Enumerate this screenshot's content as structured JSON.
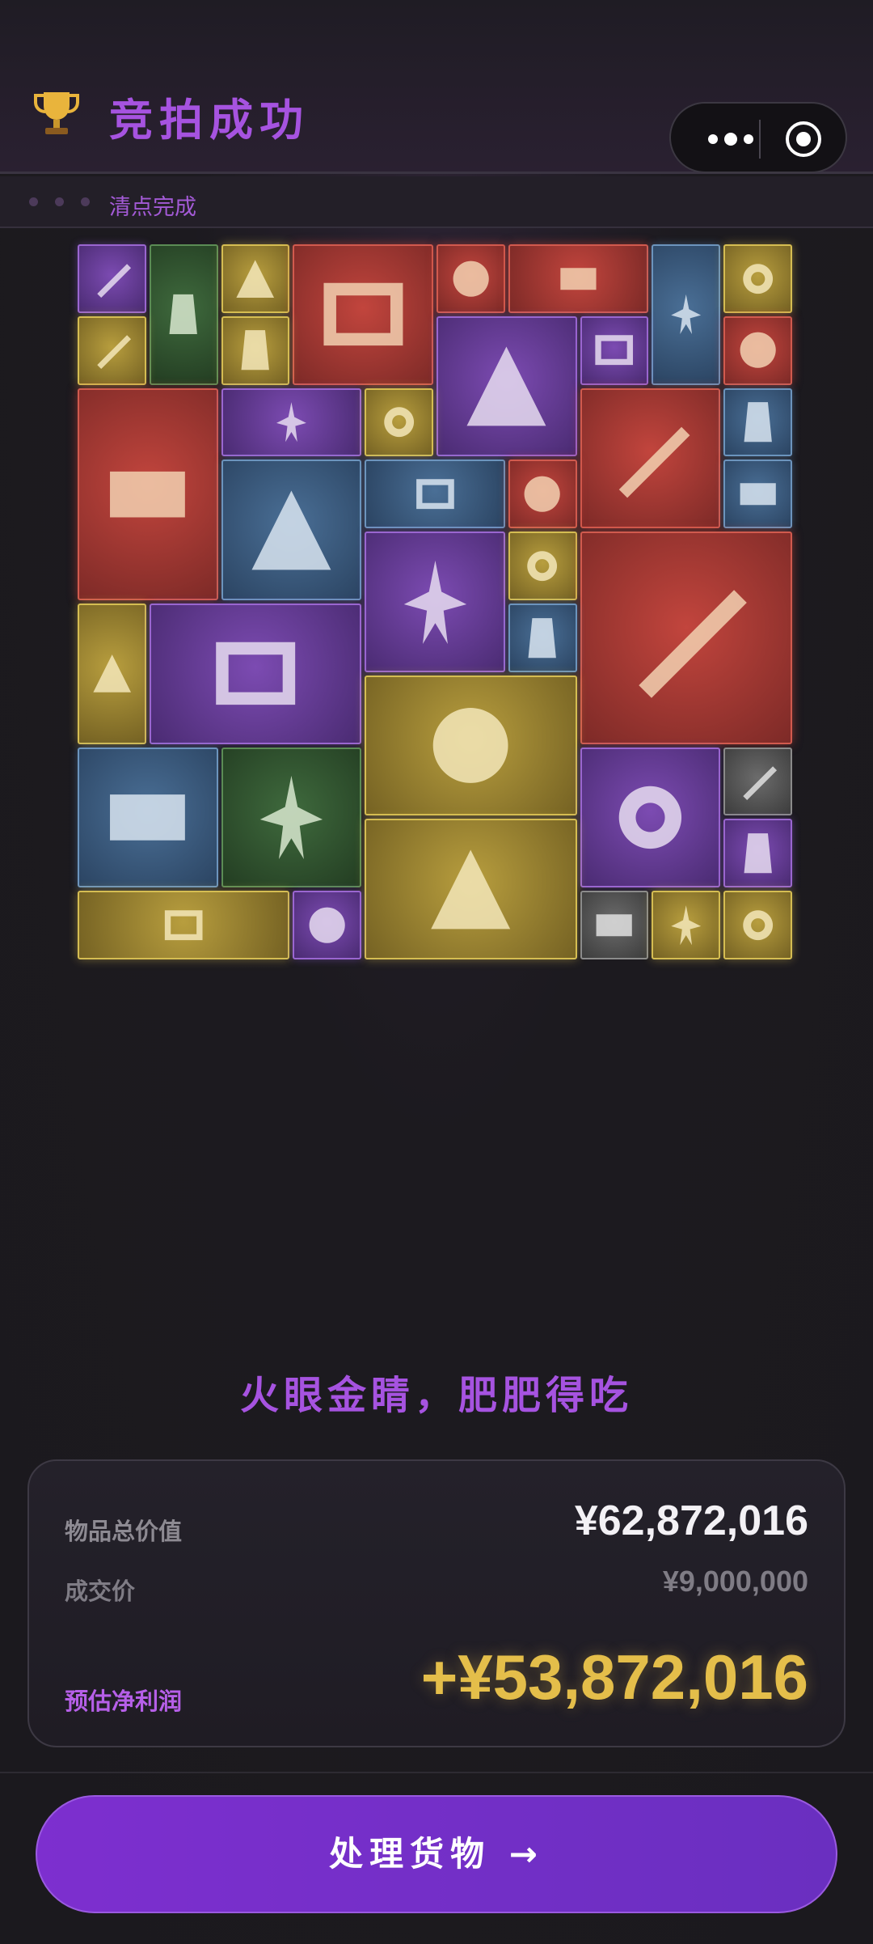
{
  "header": {
    "title": "竞拍成功",
    "trophy_icon": "trophy-icon",
    "menu_icon": "more-dots-icon",
    "close_icon": "target-circle-icon"
  },
  "progress": {
    "label": "清点完成",
    "dots": 3
  },
  "grid": {
    "items": [
      {
        "name": "knife-icon",
        "color": "purple"
      },
      {
        "name": "coffee-bag-icon",
        "color": "green"
      },
      {
        "name": "snack-pack-icon",
        "color": "gold"
      },
      {
        "name": "engine-module-icon",
        "color": "red"
      },
      {
        "name": "orb-icon",
        "color": "red"
      },
      {
        "name": "tablet-device-icon",
        "color": "red"
      },
      {
        "name": "ballerina-statue-icon",
        "color": "blue"
      },
      {
        "name": "ring-icon",
        "color": "gold"
      },
      {
        "name": "power-meter-icon",
        "color": "gold"
      },
      {
        "name": "ssd-icon",
        "color": "gold"
      },
      {
        "name": "coffee-machine-icon",
        "color": "purple"
      },
      {
        "name": "white-vest-icon",
        "color": "purple"
      },
      {
        "name": "compass-icon",
        "color": "red"
      },
      {
        "name": "bust-statue-icon",
        "color": "red"
      },
      {
        "name": "edc-pack-icon",
        "color": "purple"
      },
      {
        "name": "multimeter-icon",
        "color": "gold"
      },
      {
        "name": "radio-device-icon",
        "color": "red"
      },
      {
        "name": "caliper-icon",
        "color": "blue"
      },
      {
        "name": "thermometer-display-icon",
        "color": "blue"
      },
      {
        "name": "drill-icon",
        "color": "blue"
      },
      {
        "name": "orb-icon",
        "color": "red"
      },
      {
        "name": "mp3-player-icon",
        "color": "blue"
      },
      {
        "name": "hard-drive-icon",
        "color": "purple"
      },
      {
        "name": "bottle-icon",
        "color": "gold"
      },
      {
        "name": "framed-painting-icon",
        "color": "red"
      },
      {
        "name": "smartwatch-icon",
        "color": "blue"
      },
      {
        "name": "figurine-icon",
        "color": "gold"
      },
      {
        "name": "car-battery-icon",
        "color": "purple"
      },
      {
        "name": "generator-icon",
        "color": "gold"
      },
      {
        "name": "magazine-icon",
        "color": "blue"
      },
      {
        "name": "angle-grinder-icon",
        "color": "green"
      },
      {
        "name": "lab-device-icon",
        "color": "purple"
      },
      {
        "name": "grinding-wheel-icon",
        "color": "gray"
      },
      {
        "name": "tin-can-icon",
        "color": "purple"
      },
      {
        "name": "generator-icon",
        "color": "gold"
      },
      {
        "name": "tiara-icon",
        "color": "gold"
      },
      {
        "name": "syringe-icon",
        "color": "purple"
      },
      {
        "name": "mouse-icon",
        "color": "gray"
      },
      {
        "name": "disk-drive-icon",
        "color": "gold"
      },
      {
        "name": "chip-icon",
        "color": "gold"
      }
    ]
  },
  "tagline": "火眼金睛，肥肥得吃",
  "summary": {
    "total_label": "物品总价值",
    "total_value": "¥62,872,016",
    "deal_label": "成交价",
    "deal_value": "¥9,000,000",
    "profit_label": "预估净利润",
    "profit_value": "+¥53,872,016"
  },
  "cta": {
    "label": "处理货物 →"
  }
}
